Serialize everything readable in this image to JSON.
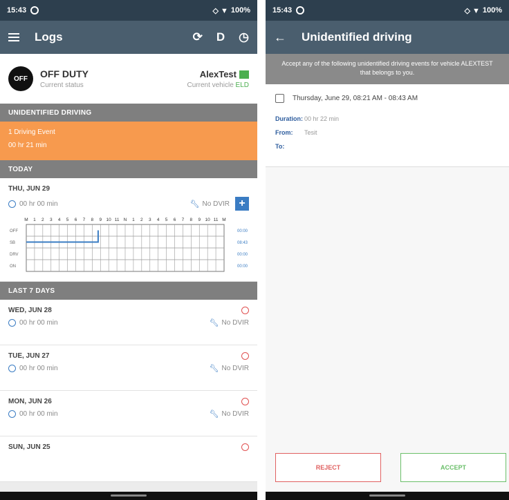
{
  "left": {
    "status_bar": {
      "time": "15:43",
      "battery": "100%"
    },
    "app_bar": {
      "title": "Logs",
      "d_label": "D"
    },
    "driver_status": {
      "badge": "OFF",
      "status": "OFF DUTY",
      "status_caption": "Current status",
      "driver": "AlexTest",
      "vehicle_caption": "Current vehicle",
      "vehicle_value": "ELD"
    },
    "unidentified_header": "UNIDENTIFIED DRIVING",
    "unidentified_event": {
      "count": "1 Driving Event",
      "duration": "00 hr 21 min"
    },
    "today_header": "TODAY",
    "today_card": {
      "date": "THU, JUN 29",
      "duration": "00 hr 00 min",
      "dvir": "No DVIR"
    },
    "graph": {
      "hour_labels": [
        "M",
        "1",
        "2",
        "3",
        "4",
        "5",
        "6",
        "7",
        "8",
        "9",
        "10",
        "11",
        "N",
        "1",
        "2",
        "3",
        "4",
        "5",
        "6",
        "7",
        "8",
        "9",
        "10",
        "11",
        "M"
      ],
      "row_labels": [
        "OFF",
        "SB",
        "DRV",
        "ON"
      ],
      "totals": [
        "00:00",
        "08:43",
        "00:00",
        "00:00"
      ]
    },
    "last7_header": "LAST 7 DAYS",
    "history": [
      {
        "date": "WED, JUN 28",
        "duration": "00 hr 00 min",
        "dvir": "No DVIR"
      },
      {
        "date": "TUE, JUN 27",
        "duration": "00 hr 00 min",
        "dvir": "No DVIR"
      },
      {
        "date": "MON, JUN 26",
        "duration": "00 hr 00 min",
        "dvir": "No DVIR"
      },
      {
        "date": "SUN, JUN 25"
      }
    ]
  },
  "right": {
    "status_bar": {
      "time": "15:43",
      "battery": "100%"
    },
    "app_bar": {
      "title": "Unidentified driving"
    },
    "info": "Accept any of the following unidentified driving events for vehicle ALEXTEST that belongs to you.",
    "event": {
      "datetime": "Thursday, June 29, 08:21 AM - 08:43 AM",
      "duration_label": "Duration:",
      "duration_value": "00 hr 22 min",
      "from_label": "From:",
      "from_value": "Tesit",
      "to_label": "To:",
      "to_value": ""
    },
    "buttons": {
      "reject": "REJECT",
      "accept": "ACCEPT"
    }
  },
  "colors": {
    "appbar": "#4a5e6e",
    "orange": "#f79a4e",
    "accent_blue": "#3a7cc3",
    "reject_red": "#e06060",
    "accept_green": "#6abf69"
  },
  "icons": [
    "menu-icon",
    "sync-icon",
    "clock-badge-icon",
    "back-arrow-icon",
    "clock-icon",
    "wrench-icon",
    "alert-icon",
    "add-icon"
  ]
}
